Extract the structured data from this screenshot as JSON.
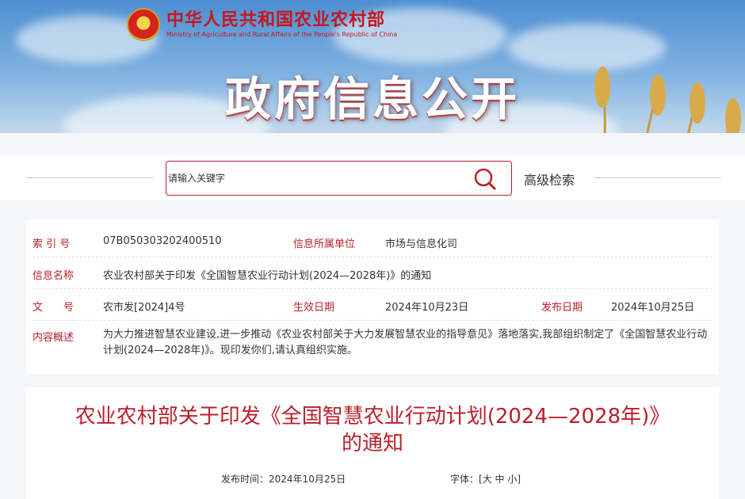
{
  "header": {
    "ministry_cn": "中华人民共和国农业农村部",
    "ministry_en": "Ministry of Agriculture and Rural Affairs of the People's Republic of China",
    "section_title": "政府信息公开"
  },
  "search": {
    "placeholder": "请输入关键字",
    "advanced_label": "高级检索"
  },
  "meta": {
    "index_label": "索 引 号",
    "index_value": "07B050303202400510",
    "unit_label": "信息所属单位",
    "unit_value": "市场与信息化司",
    "name_label": "信息名称",
    "name_value": "农业农村部关于印发《全国智慧农业行动计划(2024—2028年)》的通知",
    "doc_label": "文　　号",
    "doc_value": "农市发[2024]4号",
    "effective_label": "生效日期",
    "effective_value": "2024年10月23日",
    "publish_label": "发布日期",
    "publish_value": "2024年10月25日",
    "summary_label": "内容概述",
    "summary_value": "为大力推进智慧农业建设,进一步推动《农业农村部关于大力发展智慧农业的指导意见》落地落实,我部组织制定了《全国智慧农业行动计划(2024—2028年)》。现印发你们,请认真组织实施。"
  },
  "article": {
    "title_line1": "农业农村部关于印发《全国智慧农业行动计划(2024—2028年)》",
    "title_line2": "的通知",
    "pub_time_label": "发布时间：",
    "pub_time_value": "2024年10月25日",
    "font_label": "字体：",
    "font_open": "[",
    "font_large": "大",
    "font_medium": "中",
    "font_small": "小",
    "font_close": "]"
  },
  "colors": {
    "brand_red": "#b9202a",
    "text": "#333333"
  }
}
